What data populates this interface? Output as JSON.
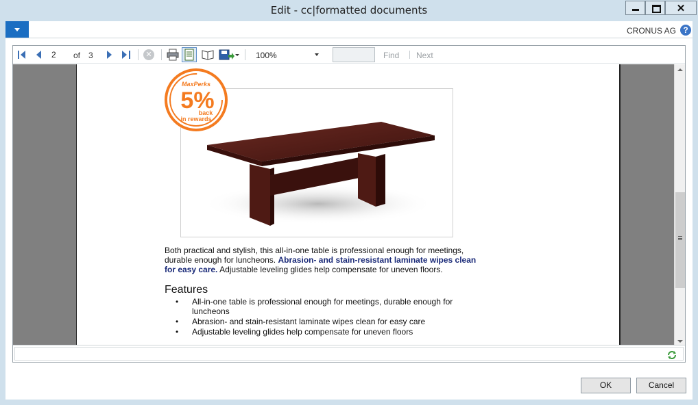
{
  "window": {
    "title": "Edit - cc|formatted documents",
    "close_glyph": "✕"
  },
  "header": {
    "company": "CRONUS AG",
    "help_glyph": "?"
  },
  "toolbar": {
    "page_current": "2",
    "of_label": "of",
    "page_total": "3",
    "zoom": "100%",
    "find_value": "",
    "find_label": "Find",
    "next_label": "Next",
    "icons": [
      "first-page-icon",
      "prev-page-icon",
      "next-page-icon",
      "last-page-icon",
      "stop-icon",
      "print-icon",
      "print-layout-icon",
      "page-setup-icon",
      "export-icon"
    ]
  },
  "report": {
    "badge": {
      "brand": "MaxPerks",
      "percent": "5%",
      "line1": "back",
      "line2": "in rewards",
      "color": "#f47b20"
    },
    "description_plain1": "Both practical and stylish, this all-in-one table is professional enough for meetings, durable enough for luncheons. ",
    "description_bold": "Abrasion- and stain-resistant laminate wipes clean for easy care.",
    "description_plain2": " Adjustable leveling glides help compensate for uneven floors.",
    "features_heading": "Features",
    "features": [
      "All-in-one table is professional enough for meetings, durable enough for luncheons",
      "Abrasion- and stain-resistant laminate wipes clean for easy care",
      "Adjustable leveling glides help compensate for uneven floors"
    ]
  },
  "buttons": {
    "ok": "OK",
    "cancel": "Cancel"
  },
  "colors": {
    "accent": "#1b6ec2",
    "badge_orange": "#f47b20",
    "bold_text": "#1a2a78",
    "wood": "#4a1c16"
  }
}
